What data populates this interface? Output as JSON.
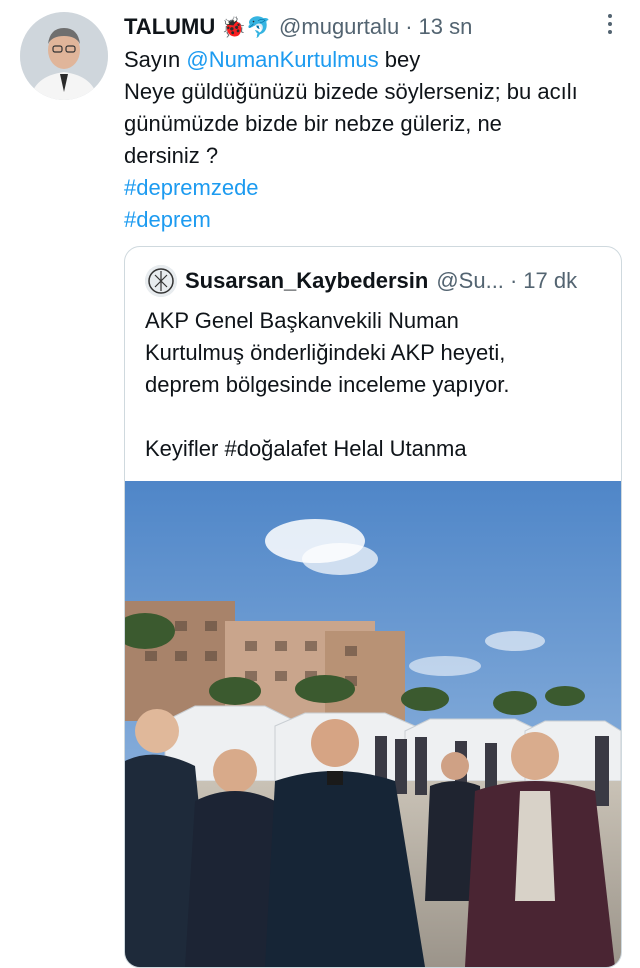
{
  "tweet": {
    "author_name": "TALUMU",
    "author_emojis": "🐞🐬",
    "handle": "@mugurtalu",
    "separator": "·",
    "time": "13 sn",
    "line1_prefix": "Sayın ",
    "mention": "@NumanKurtulmus",
    "line1_suffix": " bey",
    "line2": "Neye güldüğünüzü bizede söylerseniz; bu acılı",
    "line3": "günümüzde bizde bir nebze güleriz, ne",
    "line4": "dersiniz ?",
    "hashtag1": "#depremzede",
    "hashtag2": "#deprem"
  },
  "quoted_tweet": {
    "author_name": "Susarsan_Kaybedersin",
    "handle": "@Su...",
    "separator": "·",
    "time": "17 dk",
    "line1": "AKP Genel Başkanvekili Numan",
    "line2": "Kurtulmuş önderliğindeki AKP heyeti,",
    "line3": "deprem bölgesinde inceleme yapıyor.",
    "line4": "Keyifler #doğalafet Helal Utanma"
  },
  "icons": {
    "more": "more-dots-icon",
    "avatar": "user-avatar",
    "quoted_avatar": "quoted-user-avatar"
  },
  "colors": {
    "link": "#1d9bf0",
    "secondary_text": "#536471",
    "primary_text": "#0f1419",
    "border": "#cfd9de"
  }
}
